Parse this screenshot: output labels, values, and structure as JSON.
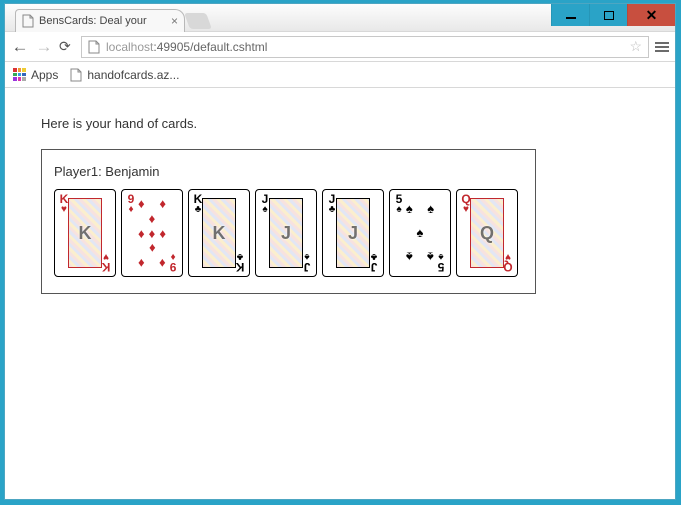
{
  "window_buttons": {
    "min": "minimize",
    "max": "maximize",
    "close": "close"
  },
  "tab": {
    "title": "BensCards: Deal your"
  },
  "omnibox": {
    "host": "localhost",
    "port_path": ":49905/default.cshtml"
  },
  "bookmarks_bar": {
    "apps_label": "Apps",
    "items": [
      {
        "label": "handofcards.az..."
      }
    ]
  },
  "page": {
    "heading": "Here is your hand of cards.",
    "player_label": "Player1: Benjamin",
    "cards": [
      {
        "rank": "K",
        "suit": "hearts",
        "suit_glyph": "♥",
        "color": "red",
        "type": "court"
      },
      {
        "rank": "9",
        "suit": "diamonds",
        "suit_glyph": "♦",
        "color": "red",
        "type": "pip"
      },
      {
        "rank": "K",
        "suit": "clubs",
        "suit_glyph": "♣",
        "color": "black",
        "type": "court"
      },
      {
        "rank": "J",
        "suit": "spades",
        "suit_glyph": "♠",
        "color": "black",
        "type": "court"
      },
      {
        "rank": "J",
        "suit": "clubs",
        "suit_glyph": "♣",
        "color": "black",
        "type": "court"
      },
      {
        "rank": "5",
        "suit": "spades",
        "suit_glyph": "♠",
        "color": "black",
        "type": "pip"
      },
      {
        "rank": "Q",
        "suit": "hearts",
        "suit_glyph": "♥",
        "color": "red",
        "type": "court"
      }
    ]
  }
}
